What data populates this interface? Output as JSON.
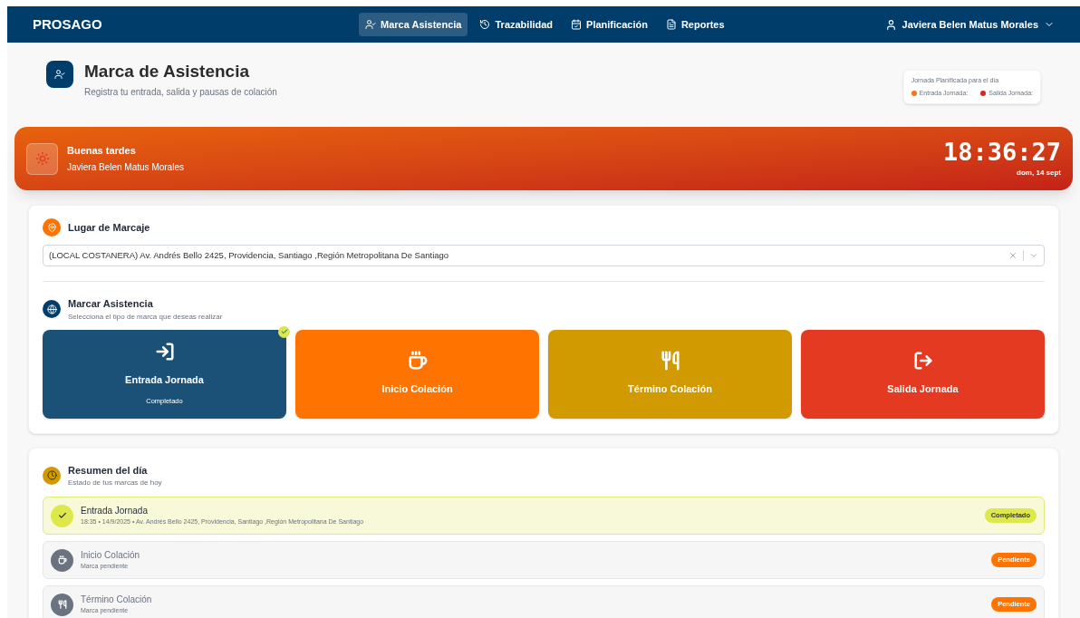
{
  "nav": {
    "logo": "PROSAGO",
    "items": [
      {
        "label": "Marca Asistencia",
        "selected": true
      },
      {
        "label": "Trazabilidad",
        "selected": false
      },
      {
        "label": "Planificación",
        "selected": false
      },
      {
        "label": "Reportes",
        "selected": false
      }
    ],
    "user": "Javiera Belen Matus Morales"
  },
  "header": {
    "title": "Marca de Asistencia",
    "subtitle": "Registra tu entrada, salida y pausas de colación"
  },
  "planned": {
    "title": "Jornada Planificada para el día",
    "entries": [
      {
        "label": "Entrada Jornada:",
        "color": "#f97316"
      },
      {
        "label": "Salida Jornada:",
        "color": "#dc2626"
      }
    ]
  },
  "greeting": {
    "title": "Buenas tardes",
    "name": "Javiera Belen Matus Morales",
    "time": "18:36:27",
    "date": "dom, 14 sept"
  },
  "location": {
    "title": "Lugar de Marcaje",
    "value": "(LOCAL COSTANERA) Av. Andrés Bello 2425, Providencia, Santiago ,Región Metropolitana De Santiago"
  },
  "marcar": {
    "title": "Marcar Asistencia",
    "subtitle": "Selecciona el tipo de marca que deseas realizar",
    "options": [
      {
        "kind": "entrada",
        "label": "Entrada Jornada",
        "completed": true,
        "status": "Completado"
      },
      {
        "kind": "inicio",
        "label": "Inicio Colación",
        "completed": false
      },
      {
        "kind": "termino",
        "label": "Término Colación",
        "completed": false
      },
      {
        "kind": "salida",
        "label": "Salida Jornada",
        "completed": false
      }
    ]
  },
  "summary": {
    "title": "Resumen del día",
    "subtitle": "Estado de tus marcas de hoy",
    "rows": [
      {
        "title": "Entrada Jornada",
        "detail": "18:35 • 14/9/2025 • Av. Andrés Bello 2425, Providencia, Santiago ,Región Metropolitana De Santiago",
        "completed": true,
        "badge": "Completado"
      },
      {
        "kind": "inicio",
        "title": "Inicio Colación",
        "detail": "Marca pendiente",
        "completed": false,
        "badge": "Pendiente"
      },
      {
        "kind": "termino",
        "title": "Término Colación",
        "detail": "Marca pendiente",
        "completed": false,
        "badge": "Pendiente"
      }
    ]
  }
}
